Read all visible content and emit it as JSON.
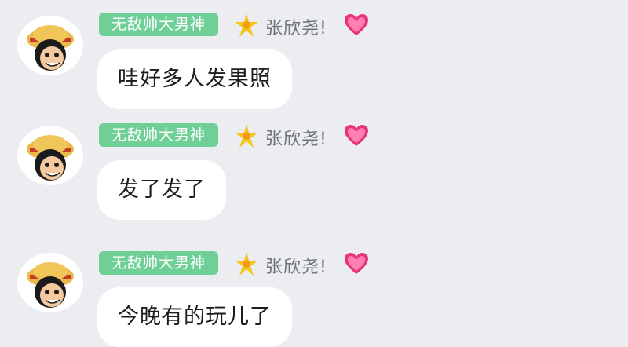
{
  "messages": [
    {
      "sender_title": "无敌帅大男神",
      "sender_name": "张欣尧!",
      "text": "哇好多人发果照",
      "avatar": "straw-hat-boy-avatar",
      "badge_icon": "star-icon",
      "name_icon": "heart-icon"
    },
    {
      "sender_title": "无敌帅大男神",
      "sender_name": "张欣尧!",
      "text": "发了发了",
      "avatar": "straw-hat-boy-avatar",
      "badge_icon": "star-icon",
      "name_icon": "heart-icon"
    },
    {
      "sender_title": "无敌帅大男神",
      "sender_name": "张欣尧!",
      "text": "今晚有的玩儿了",
      "avatar": "straw-hat-boy-avatar",
      "badge_icon": "star-icon",
      "name_icon": "heart-icon"
    }
  ],
  "colors": {
    "background": "#ebedf0",
    "title_badge": "#6fcf97",
    "bubble": "#ffffff",
    "nickname": "#6f7378",
    "star": "#f5c518",
    "heart": "#e8357a"
  }
}
